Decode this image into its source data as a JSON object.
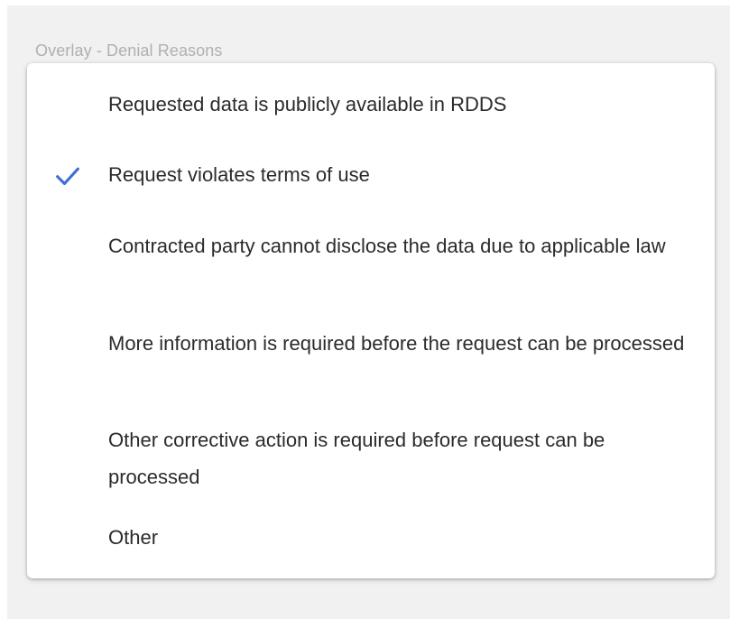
{
  "overlay": {
    "title": "Overlay - Denial Reasons"
  },
  "options": [
    {
      "label": "Requested data is publicly available in RDDS",
      "selected": false
    },
    {
      "label": "Request violates terms of use",
      "selected": true
    },
    {
      "label": "Contracted party cannot disclose the data due to applicable law",
      "selected": false
    },
    {
      "label": "More information is required before the request can be processed",
      "selected": false
    },
    {
      "label": "Other corrective action is required before request can be processed",
      "selected": false
    },
    {
      "label": "Other",
      "selected": false
    }
  ],
  "colors": {
    "check": "#3d6fd6",
    "text": "#2b2b2b",
    "title": "#b0b0b0"
  },
  "icons": {
    "selected_marker": "checkmark-icon"
  }
}
